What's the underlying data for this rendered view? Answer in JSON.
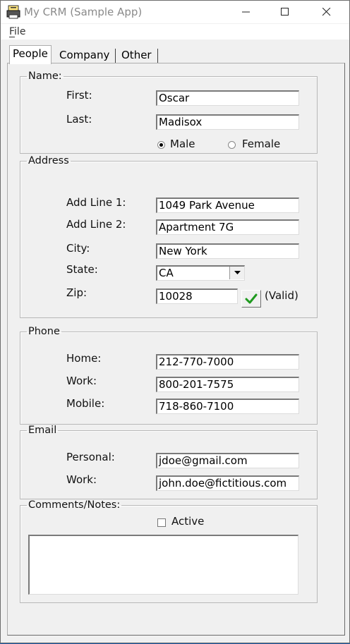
{
  "window": {
    "title": "My CRM (Sample App)"
  },
  "menu": {
    "file": "File"
  },
  "tabs": [
    {
      "label": "People",
      "selected": true
    },
    {
      "label": "Company",
      "selected": false
    },
    {
      "label": "Other",
      "selected": false
    }
  ],
  "name": {
    "legend": "Name:",
    "first_label": "First:",
    "first_value": "Oscar",
    "last_label": "Last:",
    "last_value": "Madisox",
    "gender_options": [
      "Male",
      "Female"
    ],
    "gender_selected": "Male"
  },
  "address": {
    "legend": "Address",
    "line1_label": "Add Line 1:",
    "line1_value": "1049 Park Avenue",
    "line2_label": "Add Line 2:",
    "line2_value": "Apartment 7G",
    "city_label": "City:",
    "city_value": "New York",
    "state_label": "State:",
    "state_value": "CA",
    "zip_label": "Zip:",
    "zip_value": "10028",
    "zip_status": "(Valid)"
  },
  "phone": {
    "legend": "Phone",
    "home_label": "Home:",
    "home_value": "212-770-7000",
    "work_label": "Work:",
    "work_value": "800-201-7575",
    "mobile_label": "Mobile:",
    "mobile_value": "718-860-7100"
  },
  "email": {
    "legend": "Email",
    "personal_label": "Personal:",
    "personal_value": "jdoe@gmail.com",
    "work_label": "Work:",
    "work_value": "john.doe@fictitious.com"
  },
  "notes": {
    "legend": "Comments/Notes:",
    "active_label": "Active",
    "active_checked": false,
    "text": ""
  },
  "colors": {
    "check_green": "#1f9a1f"
  }
}
